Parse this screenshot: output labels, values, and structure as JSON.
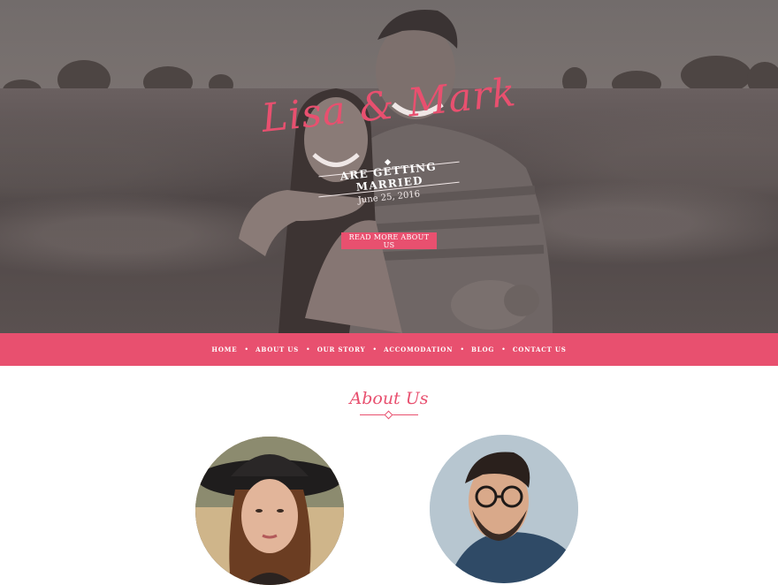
{
  "hero": {
    "title": "Lisa & Mark",
    "subtitle": "ARE GETTING MARRIED",
    "date": "June 25, 2016",
    "cta_label": "READ MORE ABOUT US"
  },
  "nav": {
    "items": [
      {
        "label": "HOME"
      },
      {
        "label": "ABOUT US"
      },
      {
        "label": "OUR STORY"
      },
      {
        "label": "ACCOMODATION"
      },
      {
        "label": "BLOG"
      },
      {
        "label": "CONTACT US"
      }
    ],
    "separator": "•"
  },
  "about": {
    "title": "About Us"
  },
  "colors": {
    "accent": "#e8506f",
    "white": "#ffffff"
  }
}
